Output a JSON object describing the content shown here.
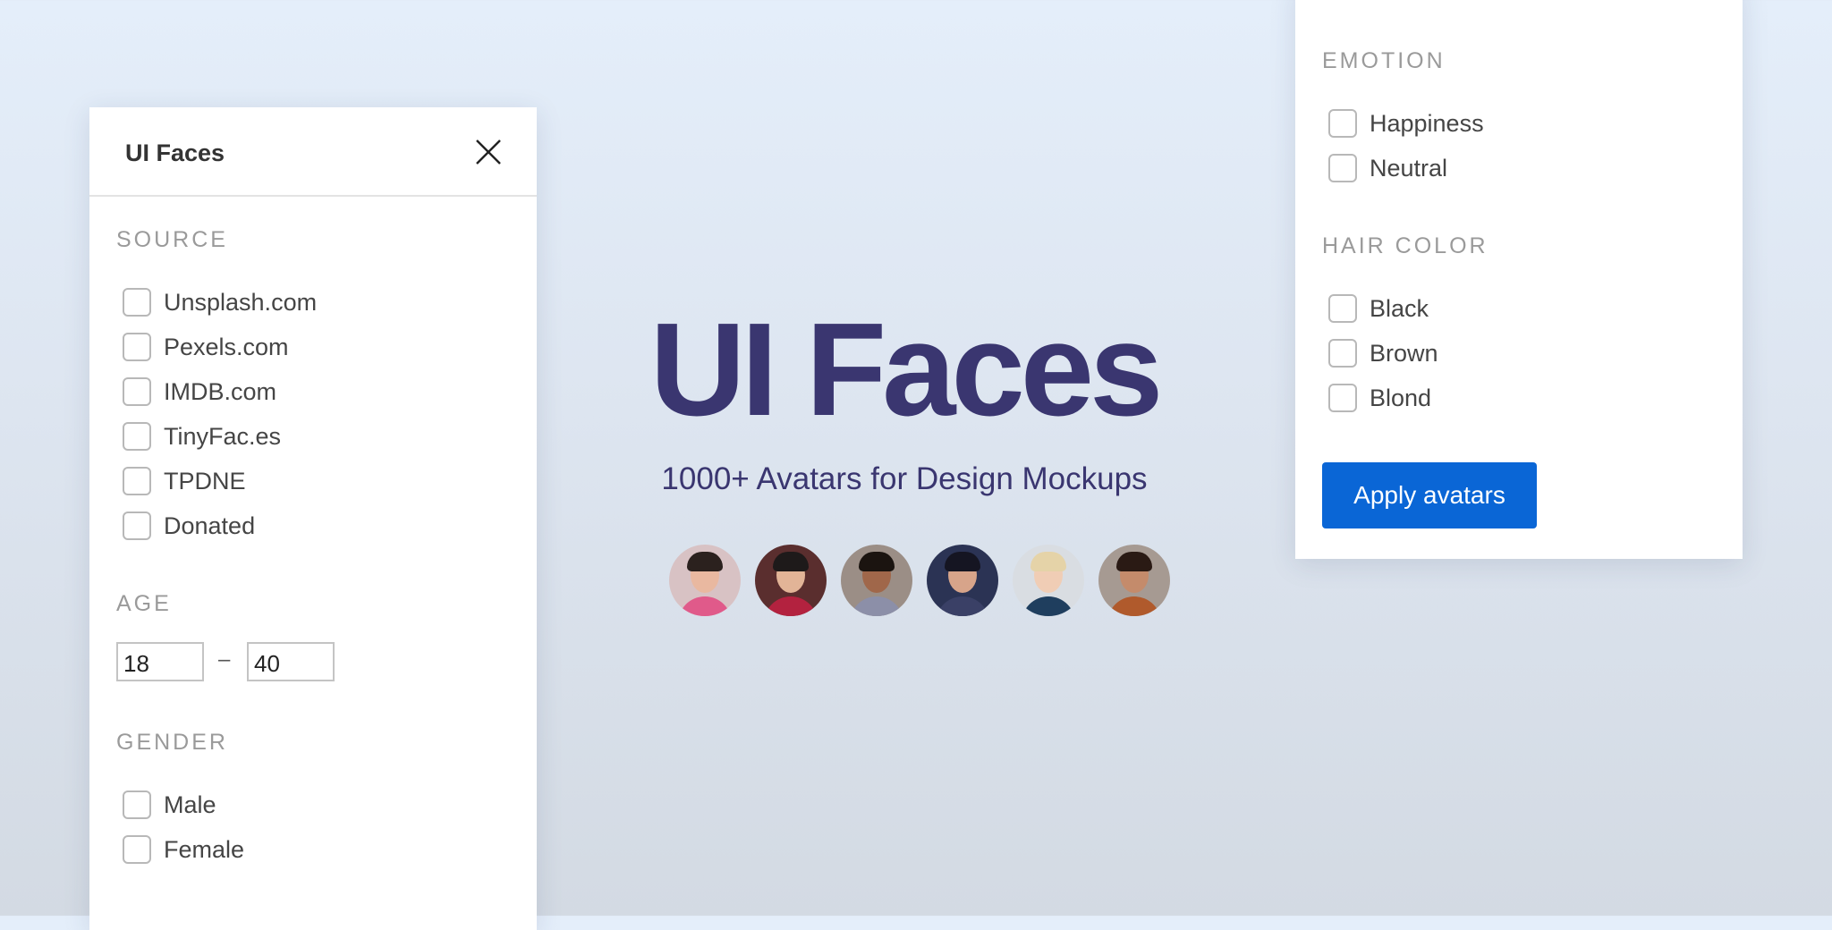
{
  "left_panel": {
    "title": "UI Faces",
    "source": {
      "label": "SOURCE",
      "options": [
        "Unsplash.com",
        "Pexels.com",
        "IMDB.com",
        "TinyFac.es",
        "TPDNE",
        "Donated"
      ]
    },
    "age": {
      "label": "AGE",
      "min": "18",
      "max": "40",
      "separator": "–"
    },
    "gender": {
      "label": "GENDER",
      "options": [
        "Male",
        "Female"
      ]
    }
  },
  "hero": {
    "title": "UI Faces",
    "subtitle": "1000+ Avatars for Design Mockups",
    "avatars": [
      {
        "icon": "avatar-man-glasses",
        "bg": "#d8c2c4",
        "skin": "#e9b8a0",
        "hair": "#2b211e",
        "shirt": "#e05a8a"
      },
      {
        "icon": "avatar-woman-hat",
        "bg": "#5a2e2e",
        "skin": "#e2b497",
        "hair": "#1e1a1a",
        "shirt": "#b3223f"
      },
      {
        "icon": "avatar-man-smiling",
        "bg": "#9b8e86",
        "skin": "#a0674a",
        "hair": "#1b1410",
        "shirt": "#8c8fa8"
      },
      {
        "icon": "avatar-woman-dark-hair",
        "bg": "#2b3354",
        "skin": "#d7a48a",
        "hair": "#151522",
        "shirt": "#3a4066"
      },
      {
        "icon": "avatar-woman-blond",
        "bg": "#d9dde2",
        "skin": "#f0cdb5",
        "hair": "#e5d3a8",
        "shirt": "#1f3e5e"
      },
      {
        "icon": "avatar-woman-brown-hair",
        "bg": "#a69a92",
        "skin": "#c48b6b",
        "hair": "#2a1a14",
        "shirt": "#b05a2c"
      }
    ]
  },
  "right_panel": {
    "emotion": {
      "label": "EMOTION",
      "options": [
        "Happiness",
        "Neutral"
      ]
    },
    "hair_color": {
      "label": "HAIR COLOR",
      "options": [
        "Black",
        "Brown",
        "Blond"
      ]
    },
    "apply_label": "Apply avatars"
  },
  "colors": {
    "accent": "#0a66d6",
    "hero_text": "#3a3670"
  }
}
